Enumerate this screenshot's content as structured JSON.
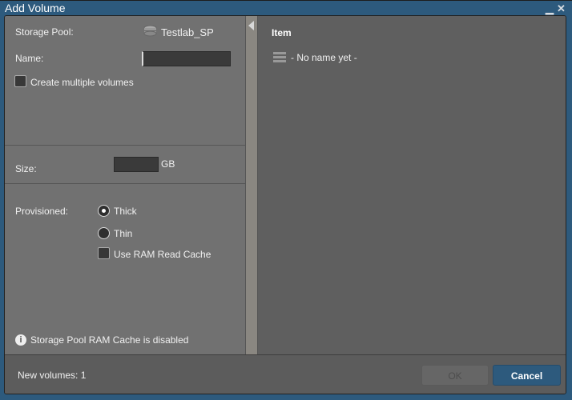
{
  "window": {
    "title": "Add Volume",
    "minimize_icon": "minimize-icon",
    "close_icon": "close-icon"
  },
  "form": {
    "storage_pool_label": "Storage Pool:",
    "storage_pool_value": "Testlab_SP",
    "name_label": "Name:",
    "name_value": "",
    "create_multiple_label": "Create multiple volumes",
    "create_multiple_checked": false,
    "size_label": "Size:",
    "size_value": "",
    "size_unit": "GB",
    "provisioned_label": "Provisioned:",
    "provisioned_options": [
      {
        "label": "Thick",
        "selected": true
      },
      {
        "label": "Thin",
        "selected": false
      }
    ],
    "ram_cache_label": "Use RAM Read Cache",
    "ram_cache_checked": false,
    "info_text": "Storage Pool RAM Cache is disabled"
  },
  "preview": {
    "header": "Item",
    "items": [
      {
        "name": "- No name yet -"
      }
    ]
  },
  "footer": {
    "count_text": "New volumes: 1",
    "ok_label": "OK",
    "cancel_label": "Cancel"
  }
}
